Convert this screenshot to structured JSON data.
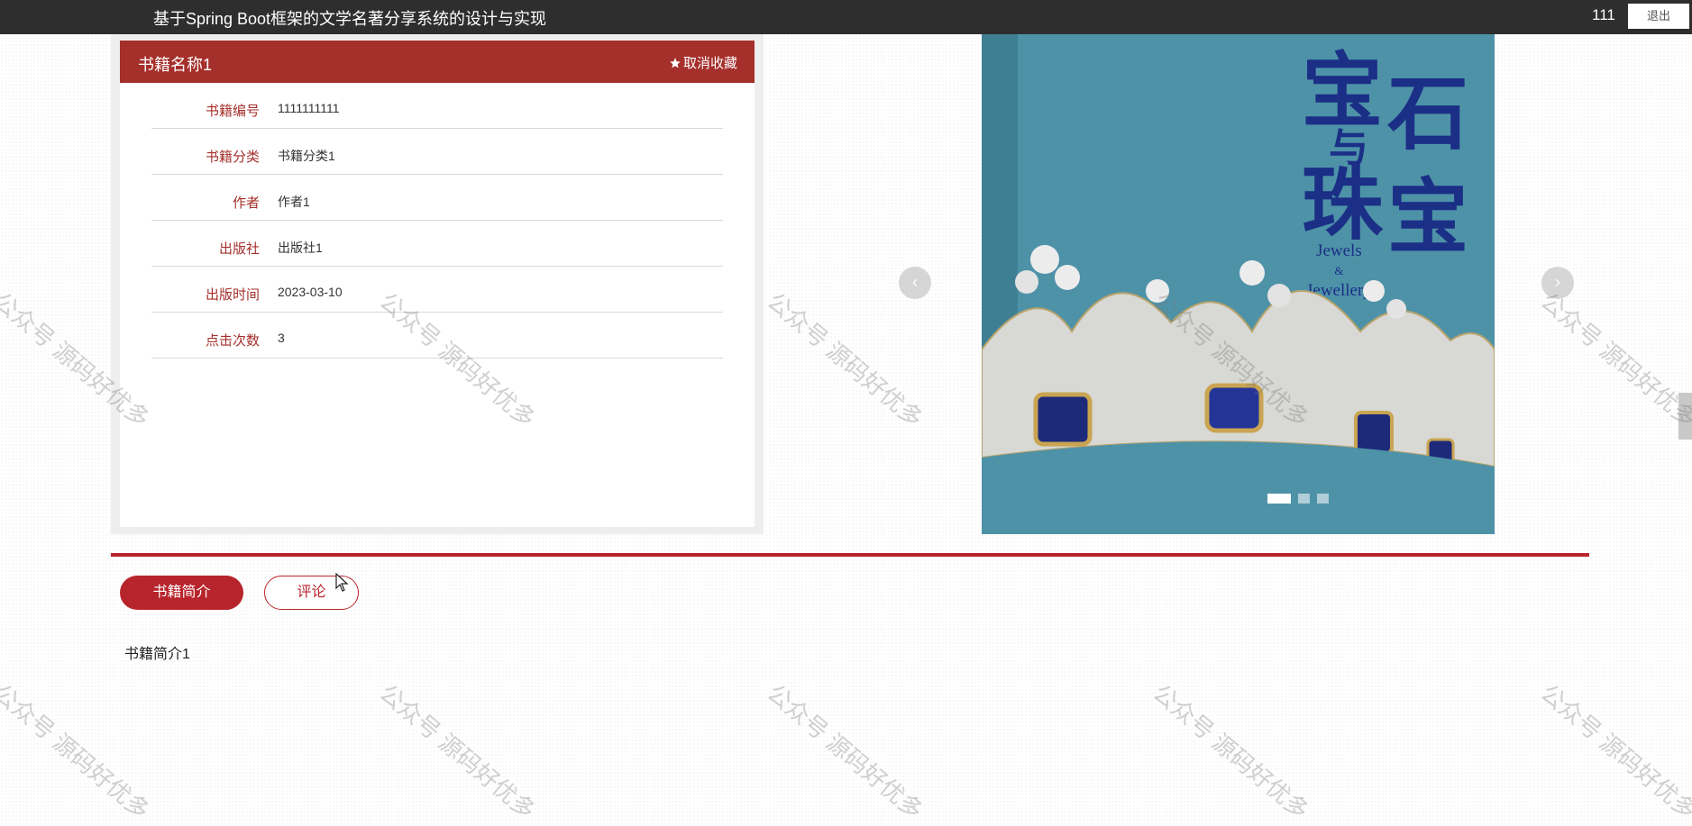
{
  "header": {
    "title": "基于Spring Boot框架的文学名著分享系统的设计与实现",
    "username": "111",
    "logout_label": "退出"
  },
  "book": {
    "name": "书籍名称1",
    "favorite_label": "取消收藏",
    "fields": [
      {
        "label": "书籍编号",
        "value": "1111111111"
      },
      {
        "label": "书籍分类",
        "value": "书籍分类1"
      },
      {
        "label": "作者",
        "value": "作者1"
      },
      {
        "label": "出版社",
        "value": "出版社1"
      },
      {
        "label": "出版时间",
        "value": "2023-03-10"
      },
      {
        "label": "点击次数",
        "value": "3"
      }
    ]
  },
  "carousel": {
    "cover_title_cn": [
      "宝",
      "石",
      "与",
      "珠",
      "宝"
    ],
    "cover_title_en": [
      "Jewels",
      "&",
      "Jewellery"
    ],
    "slide_count": 3,
    "active_index": 0
  },
  "tabs": [
    {
      "label": "书籍简介",
      "active": true
    },
    {
      "label": "评论",
      "active": false
    }
  ],
  "intro_text": "书籍简介1",
  "watermark_text": "公众号 源码好优多",
  "colors": {
    "accent": "#b8242c",
    "header_red": "#a52f2b",
    "topbar": "#2e2e2e"
  }
}
